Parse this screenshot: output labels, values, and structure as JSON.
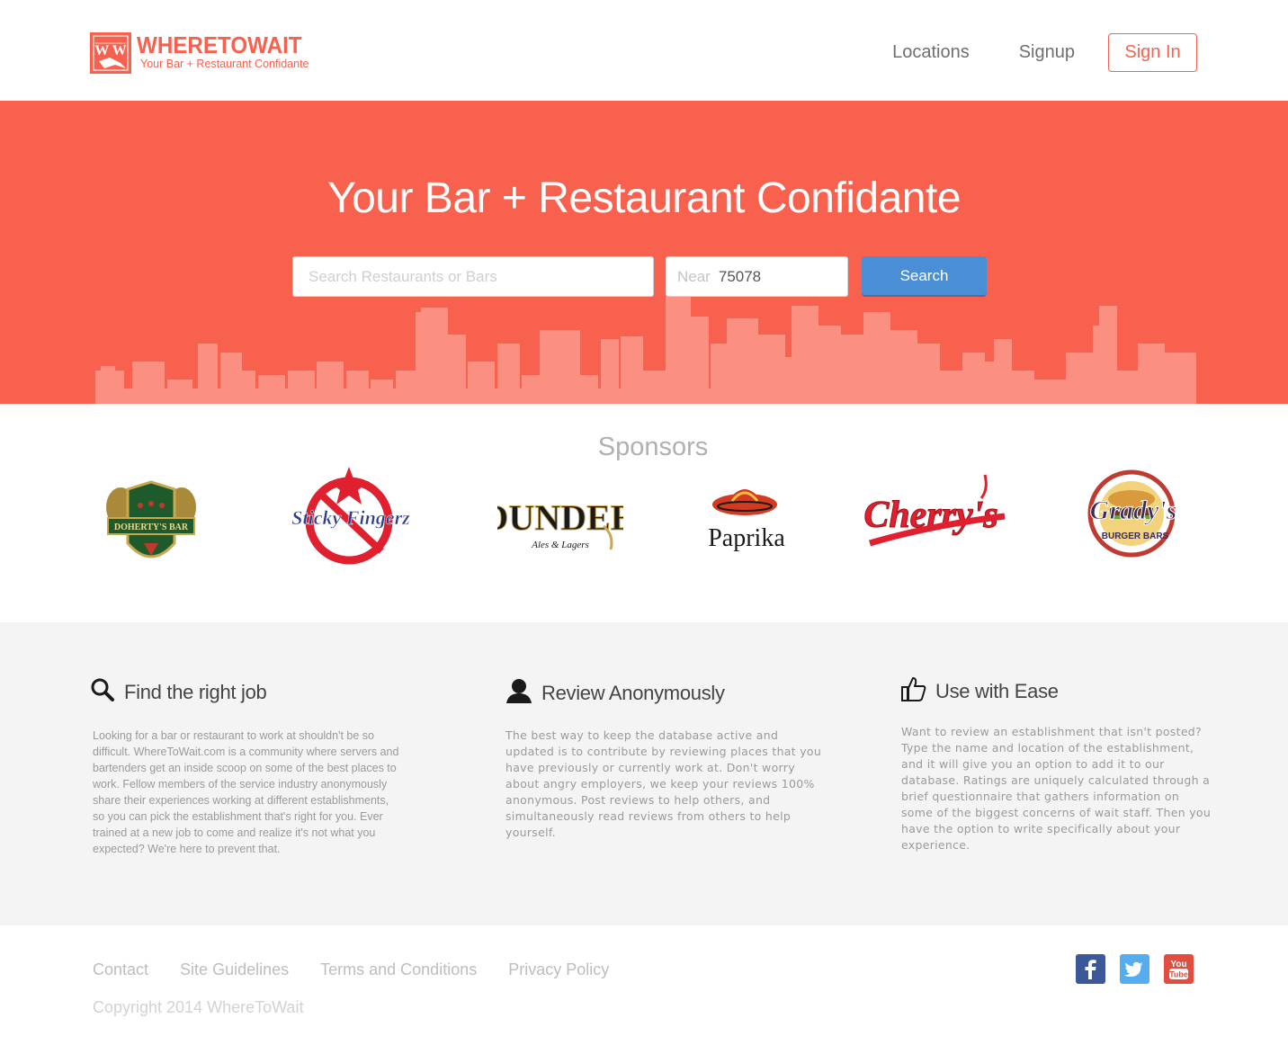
{
  "header": {
    "logo_name": "WHERETOWAIT",
    "logo_tagline": "Your Bar + Restaurant Confidante",
    "logo_mark": "W W",
    "nav": {
      "locations": "Locations",
      "signup": "Signup",
      "signin": "Sign In"
    }
  },
  "hero": {
    "title": "Your Bar + Restaurant Confidante",
    "search_placeholder": "Search Restaurants or Bars",
    "near_label": "Near",
    "near_value": "75078",
    "search_button": "Search"
  },
  "sponsors": {
    "title": "Sponsors",
    "items": [
      {
        "name": "DOHERTY'S BAR"
      },
      {
        "name": "Sticky Fingerz"
      },
      {
        "name": "DUNDEE",
        "subtitle": "Ales & Lagers"
      },
      {
        "name": "Paprika"
      },
      {
        "name": "Cherry's"
      },
      {
        "name": "Grady's",
        "subtitle": "BURGER BARS"
      }
    ]
  },
  "features": [
    {
      "icon": "search-icon",
      "title": "Find the right job",
      "text": "Looking for a bar or restaurant to work at shouldn't be so difficult. WhereToWait.com is a community where servers and bartenders get an inside scoop on some of the best places to work. Fellow members of the service industry anonymously share their experiences working at different establishments, so you can pick the establishment that's right for you. Ever trained at a new job to come and realize it's not what you expected? We're here to prevent that."
    },
    {
      "icon": "user-icon",
      "title": "Review Anonymously",
      "text": "The best way to keep the database active and updated is to contribute by reviewing places that you have previously or currently work at. Don't worry about angry employers, we keep your reviews 100% anonymous. Post reviews to help others, and simultaneously read reviews from others to help yourself."
    },
    {
      "icon": "thumbs-up-icon",
      "title": "Use with Ease",
      "text": "Want to review an establishment that isn't posted? Type the name and location of the establishment, and it will give you an option to add it to our database. Ratings are uniquely calculated through a brief questionnaire that gathers information on some of the biggest concerns of wait staff. Then you have the option to write specifically about your experience."
    }
  ],
  "footer": {
    "links": [
      "Contact",
      "Site Guidelines",
      "Terms and Conditions",
      "Privacy Policy"
    ],
    "copyright": "Copyright 2014 WhereToWait",
    "socials": [
      {
        "icon": "facebook-icon",
        "label": "f",
        "color": "#3b5998"
      },
      {
        "icon": "twitter-icon",
        "label": "t",
        "color": "#55acee"
      },
      {
        "icon": "youtube-icon",
        "label": "You Tube",
        "color": "#e34d3f"
      }
    ]
  },
  "colors": {
    "accent": "#f9614f",
    "search_button": "#4a8fd6",
    "features_bg": "#f4f4f4"
  }
}
